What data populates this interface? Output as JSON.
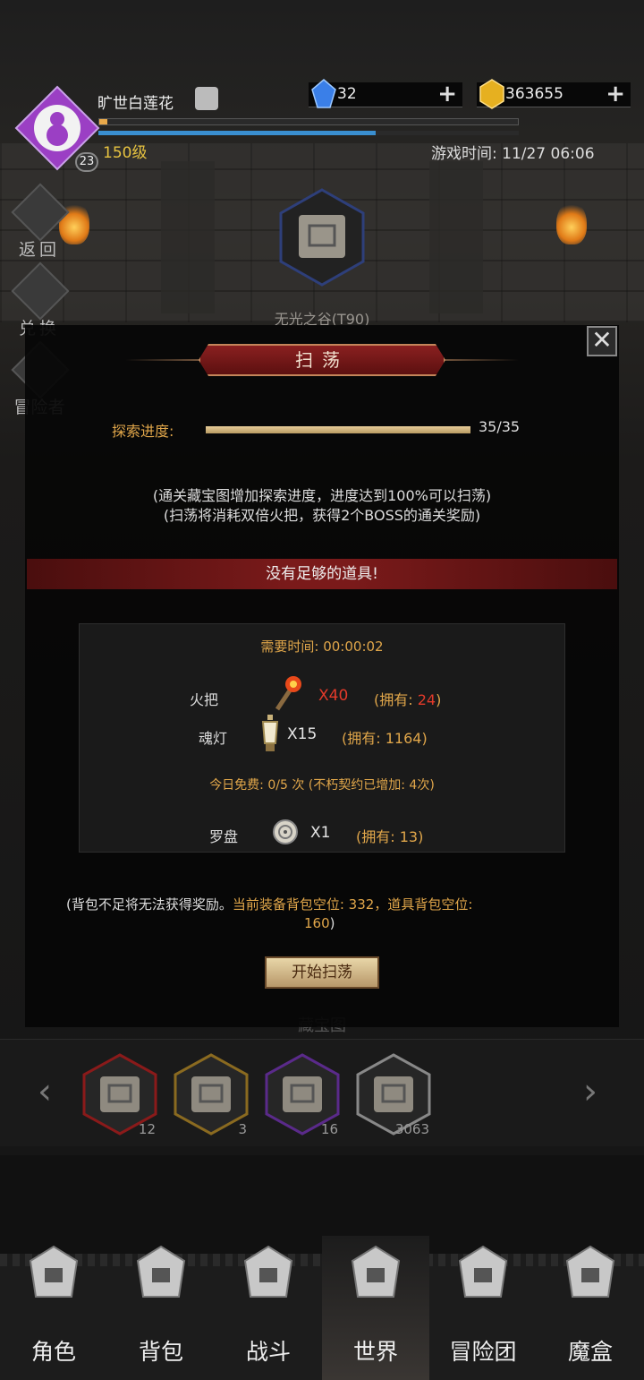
{
  "player": {
    "name": "旷世白莲花",
    "avatar_level": "23",
    "level_text": "150级",
    "exp_fraction": 0.02,
    "mp_fraction": 0.66
  },
  "resources": {
    "gems": "32",
    "gold": "363655"
  },
  "game_time": "游戏时间: 11/27 06:06",
  "side_buttons": {
    "back": "返回",
    "exchange": "兑换",
    "adventurer": "冒险者"
  },
  "map": {
    "name": "无光之谷(T90)"
  },
  "dialog": {
    "title": "扫荡",
    "progress_label": "探索进度:",
    "progress_current": 35,
    "progress_total": 35,
    "progress_text": "35/35",
    "desc_line1": "(通关藏宝图增加探索进度，进度达到100%可以扫荡)",
    "desc_line2": "(扫荡将消耗双倍火把，获得2个BOSS的通关奖励)",
    "warning": "没有足够的道具!",
    "need_time": "需要时间: 00:00:02",
    "items": [
      {
        "name": "火把",
        "icon": "torch-icon",
        "qty": "X40",
        "own": "(拥有: ",
        "own_val": "24",
        "own_end": ")"
      },
      {
        "name": "魂灯",
        "icon": "soul-lamp-icon",
        "qty": "X15",
        "own": "(拥有: 1164)"
      },
      {
        "name": "罗盘",
        "icon": "compass-icon",
        "qty": "X1",
        "own": "(拥有: 13)"
      }
    ],
    "free_today": "今日免费: 0/5 次 (不朽契约已增加: 4次)",
    "bag_note_prefix": "(背包不足将无法获得奖励。",
    "bag_note_gold": "当前装备背包空位: 332，道具背包空位:",
    "bag_note_line2_gold": "160",
    "bag_note_line2_end": ")",
    "start_button": "开始扫荡"
  },
  "map_strip": {
    "title": "藏宝图",
    "cards": [
      {
        "count": "12",
        "color": "#8a1a1a"
      },
      {
        "count": "3",
        "color": "#8a6a20"
      },
      {
        "count": "16",
        "color": "#5a2a8a"
      },
      {
        "count": "3063",
        "color": "#888888"
      }
    ]
  },
  "nav": {
    "items": [
      {
        "label": "角色",
        "icon": "helmet-icon"
      },
      {
        "label": "背包",
        "icon": "backpack-icon"
      },
      {
        "label": "战斗",
        "icon": "swords-icon"
      },
      {
        "label": "世界",
        "icon": "world-map-icon"
      },
      {
        "label": "冒险团",
        "icon": "castle-icon"
      },
      {
        "label": "魔盒",
        "icon": "magic-cube-icon"
      }
    ],
    "active_index": 3
  },
  "colors": {
    "accent_gold": "#e0a64a",
    "warning_red": "#7a1a1a",
    "avatar_purple": "#9b3fc4"
  }
}
